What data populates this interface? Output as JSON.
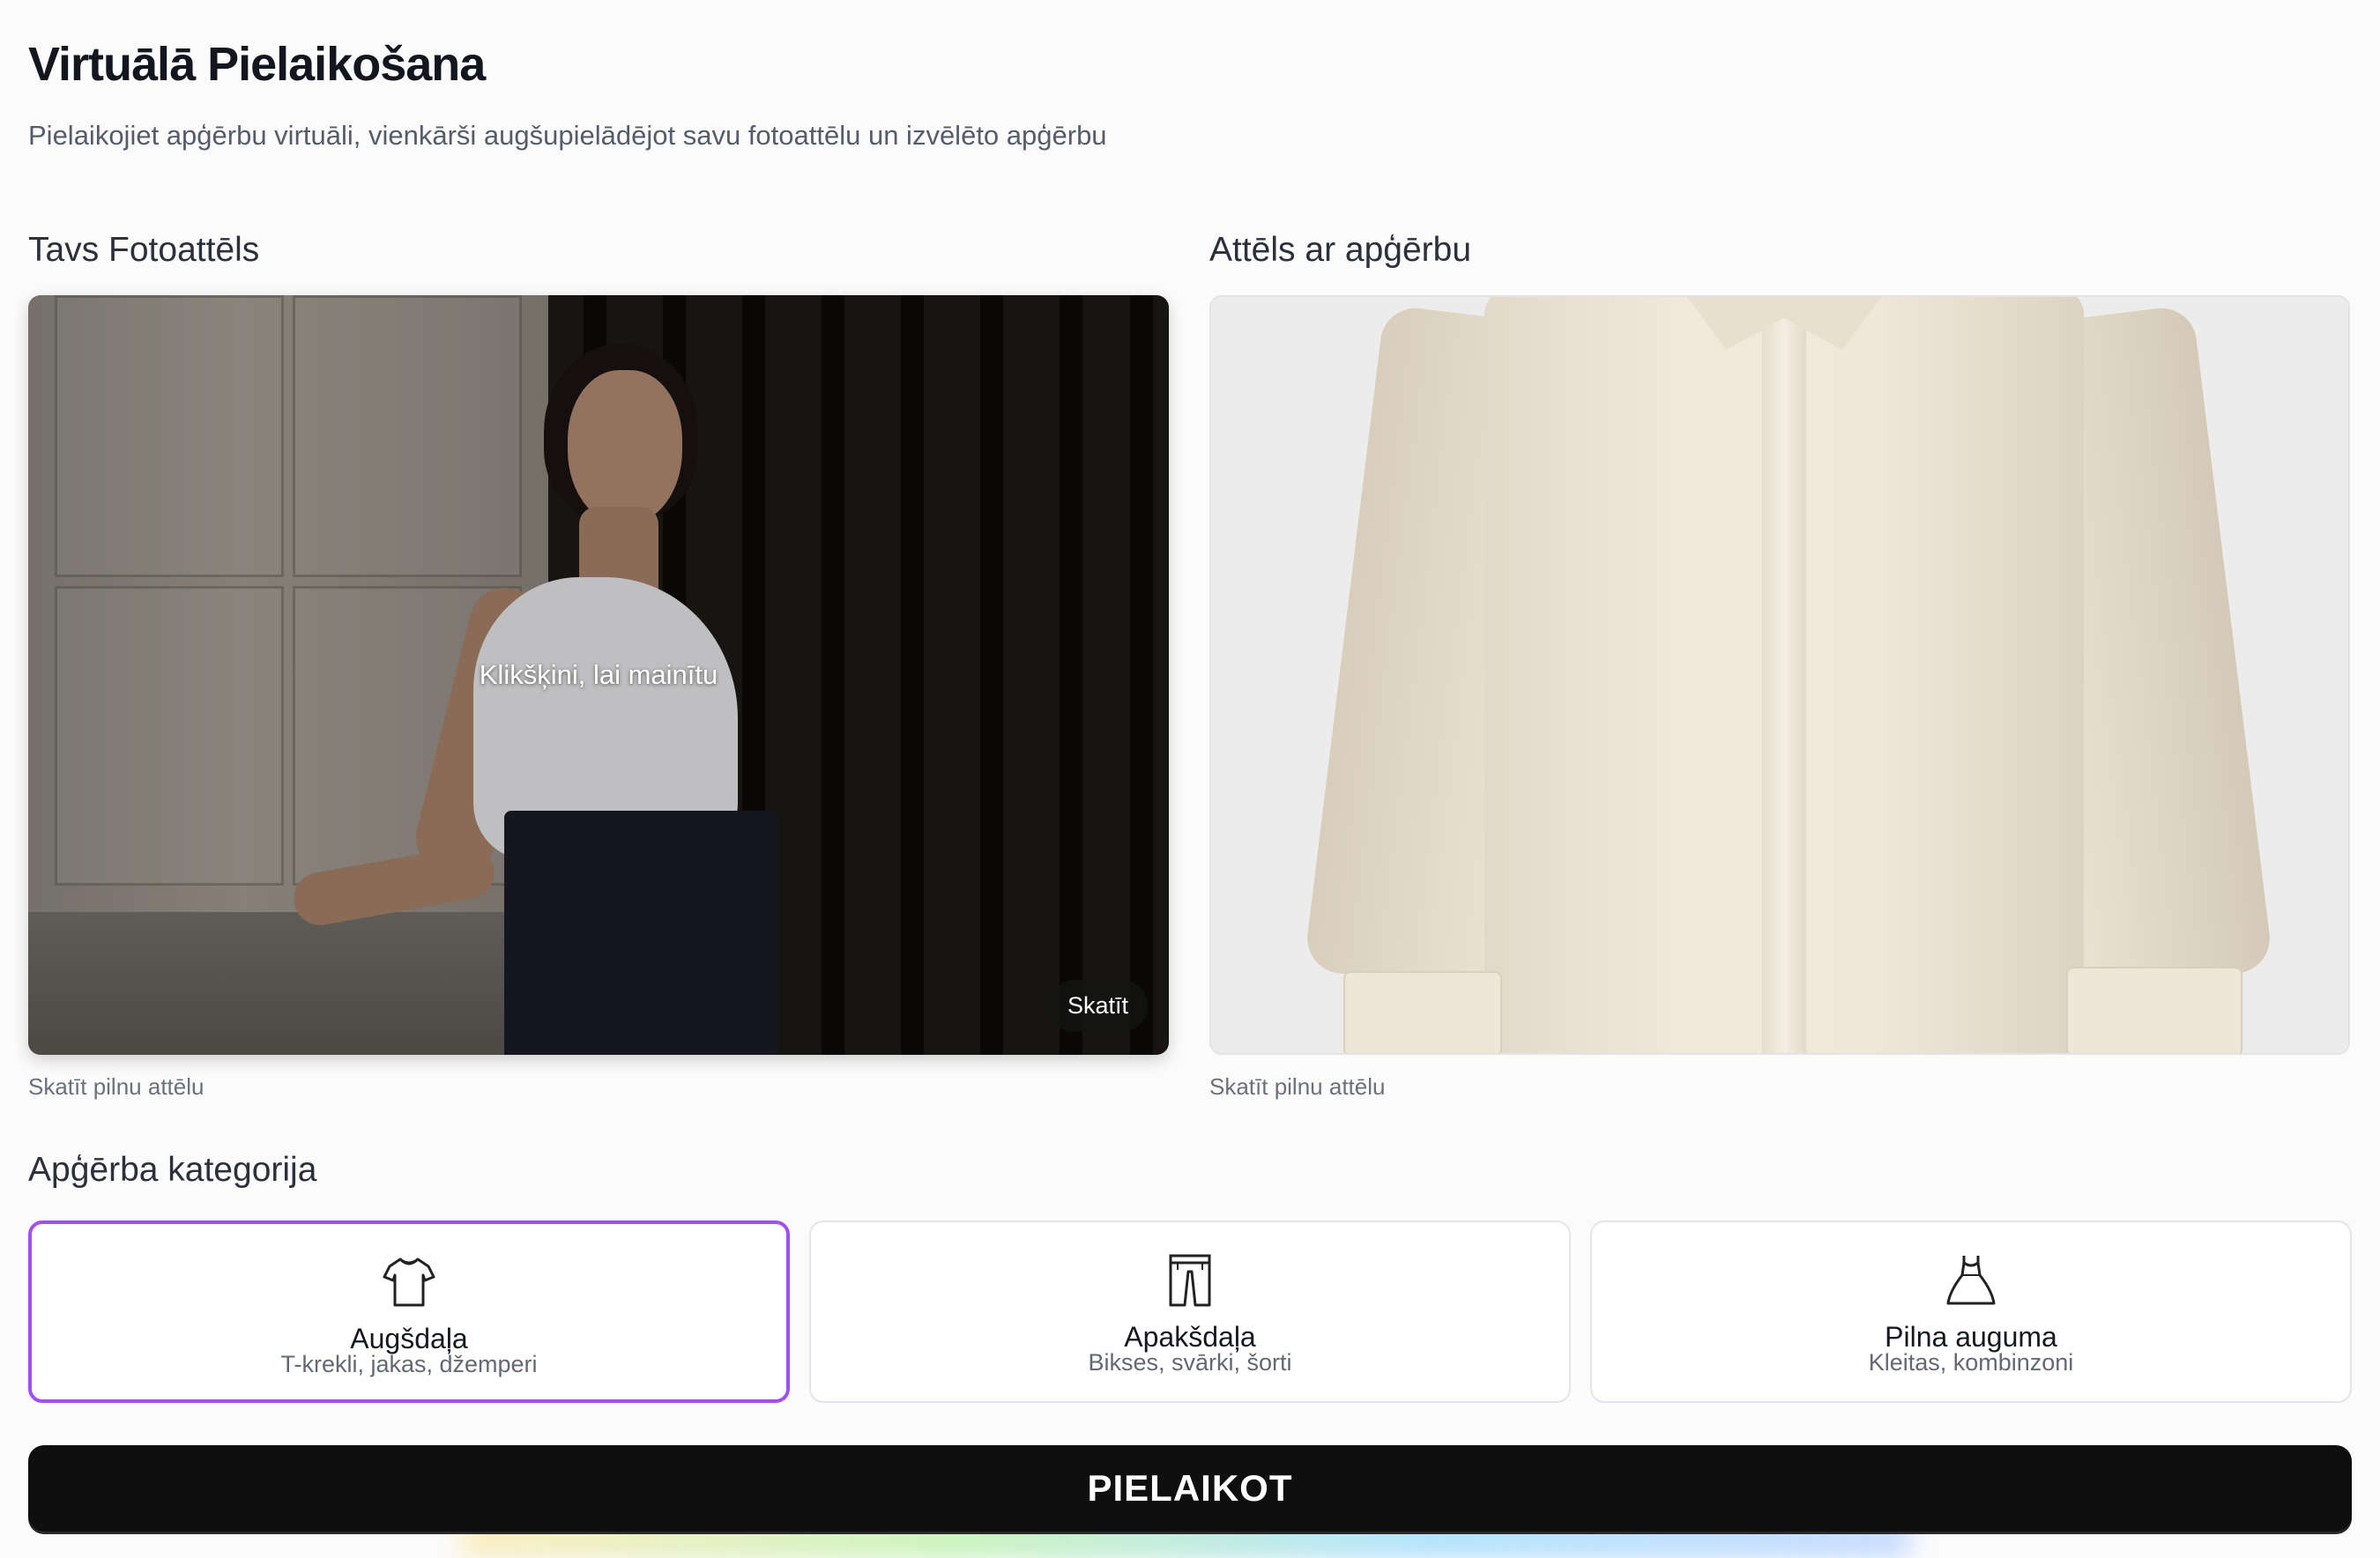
{
  "header": {
    "title": "Virtuālā Pielaikošana",
    "subtitle": "Pielaikojiet apģērbu virtuāli, vienkārši augšupielādējot savu fotoattēlu un izvēlēto apģērbu"
  },
  "photo_panel": {
    "label": "Tavs Fotoattēls",
    "change_hint": "Klikšķini, lai mainītu",
    "view_button": "Skatīt",
    "caption": "Skatīt pilnu attēlu"
  },
  "garment_panel": {
    "label": "Attēls ar apģērbu",
    "caption": "Skatīt pilnu attēlu"
  },
  "category": {
    "label": "Apģērba kategorija",
    "options": [
      {
        "name": "Augšdaļa",
        "desc": "T-krekli, jakas, džemperi",
        "icon": "tshirt-icon",
        "selected": true
      },
      {
        "name": "Apakšdaļa",
        "desc": "Bikses, svārki, šorti",
        "icon": "pants-icon",
        "selected": false
      },
      {
        "name": "Pilna auguma",
        "desc": "Kleitas, kombinzoni",
        "icon": "dress-icon",
        "selected": false
      }
    ],
    "selected_color": "#a150f0"
  },
  "submit": {
    "label": "PIELAIKOT"
  }
}
